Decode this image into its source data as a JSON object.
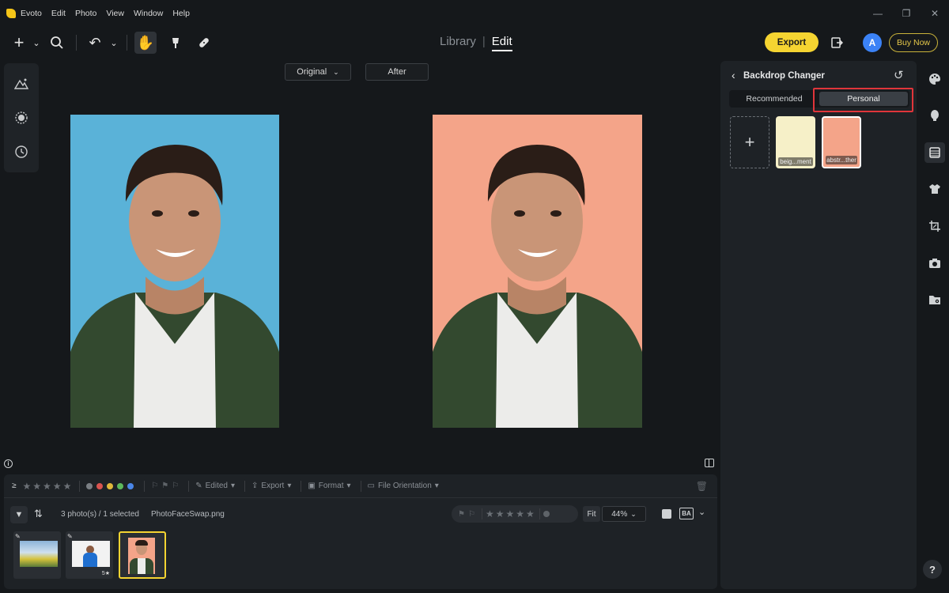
{
  "app": {
    "name": "Evoto"
  },
  "menu": [
    "Edit",
    "Photo",
    "View",
    "Window",
    "Help"
  ],
  "toolbar": {
    "library": "Library",
    "edit": "Edit",
    "export": "Export",
    "avatar": "A",
    "buy_now": "Buy Now"
  },
  "canvas": {
    "original_label": "Original",
    "after_label": "After"
  },
  "right_panel": {
    "title": "Backdrop Changer",
    "tabs": [
      {
        "label": "Recommended",
        "active": false
      },
      {
        "label": "Personal",
        "active": true
      }
    ],
    "swatches": [
      {
        "label": "beig...ment",
        "color": "#f6f0c8",
        "selected": false
      },
      {
        "label": "abstr...ther",
        "color": "#f4a489",
        "selected": true
      }
    ]
  },
  "bottom": {
    "filters": {
      "edited": "Edited",
      "export": "Export",
      "format": "Format",
      "orientation": "File Orientation"
    },
    "photo_count": "3 photo(s) / 1 selected",
    "filename": "PhotoFaceSwap.png",
    "fit": "Fit",
    "zoom": "44%",
    "ba": "BA",
    "thumb2_rating": "5★"
  },
  "colors": {
    "accent": "#f5d431",
    "highlight": "#e0353a",
    "original_bg": "#5ab2d8",
    "after_bg": "#f4a489"
  }
}
